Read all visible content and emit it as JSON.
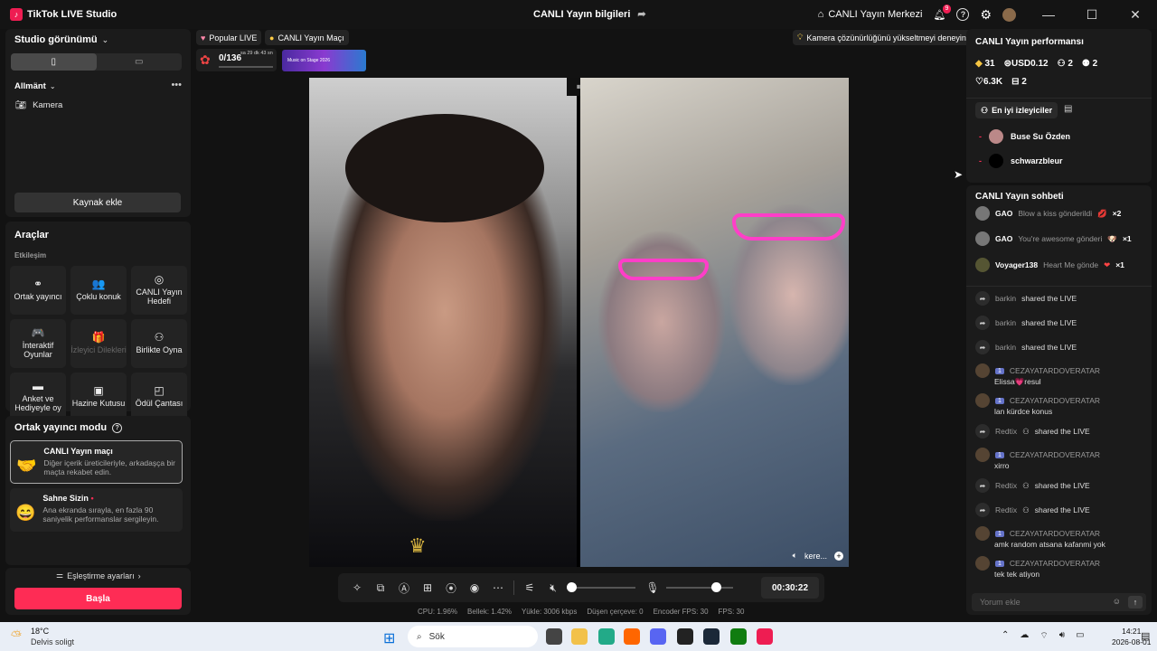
{
  "titlebar": {
    "app_name": "TikTok LIVE Studio",
    "center_title": "CANLI Yayın bilgileri",
    "live_center": "CANLI Yayın Merkezi",
    "notif_count": "9"
  },
  "left": {
    "studio_view": "Studio görünümü",
    "scene_label": "Allmänt",
    "source_camera": "Kamera",
    "add_source": "Kaynak ekle",
    "tools_title": "Araçlar",
    "interaction": "Etkileşim",
    "tools": [
      {
        "label": "Ortak yayıncı",
        "icon": "link-icon",
        "glyph": "⚭",
        "enabled": true
      },
      {
        "label": "Çoklu konuk",
        "icon": "users-icon",
        "glyph": "👥",
        "enabled": true
      },
      {
        "label": "CANLI Yayın Hedefi",
        "icon": "target-icon",
        "glyph": "◎",
        "enabled": true
      },
      {
        "label": "İnteraktif Oyunlar",
        "icon": "gamepad-icon",
        "glyph": "🎮",
        "enabled": true
      },
      {
        "label": "İzleyici Dilekleri",
        "icon": "gift-icon",
        "glyph": "🎁",
        "enabled": false
      },
      {
        "label": "Birlikte Oyna",
        "icon": "play-together-icon",
        "glyph": "⚇",
        "enabled": true
      },
      {
        "label": "Anket ve Hediyeyle oy",
        "icon": "poll-icon",
        "glyph": "▬",
        "enabled": true
      },
      {
        "label": "Hazine Kutusu",
        "icon": "treasure-icon",
        "glyph": "▣",
        "enabled": true
      },
      {
        "label": "Ödül Çantası",
        "icon": "bag-icon",
        "glyph": "◰",
        "enabled": true
      }
    ],
    "cohost_mode": "Ortak yayıncı modu",
    "mode1_title": "CANLI Yayın maçı",
    "mode1_desc": "Diğer içerik üreticileriyle, arkadaşça bir maçta rekabet edin.",
    "mode2_title": "Sahne Sizin",
    "mode2_desc": "Ana ekranda sırayla, en fazla 90 saniyelik performanslar sergileyin.",
    "pairing_settings": "Eşleştirme ayarları",
    "start": "Başla"
  },
  "center": {
    "tag1": "Popular LIVE",
    "tag2": "CANLI Yayın Maçı",
    "hint": "Kamera çözünürlüğünü yükseltmeyi deneyin",
    "goal_count": "0/136",
    "goal_time": "sa 29 dk 43 sn",
    "banner_text": "Music on Stage 2026",
    "guest_name": "kere...",
    "timer": "00:30:22",
    "stats": [
      "CPU: 1.96%",
      "Bellek: 1.42%",
      "Yükle: 3006 kbps",
      "Düşen çerçeve: 0",
      "Encoder FPS: 30",
      "FPS: 30"
    ]
  },
  "right": {
    "perf_title": "CANLI Yayın performansı",
    "perf": {
      "diamonds": "31",
      "usd": "USD0.12",
      "viewers": "2",
      "followers": "2",
      "likes": "6.3K",
      "gifts": "2"
    },
    "top_viewers_tab": "En iyi izleyiciler",
    "viewers": [
      {
        "rank": "-",
        "name": "Buse Su Özden"
      },
      {
        "rank": "-",
        "name": "schwarzbleur"
      }
    ],
    "chat_title": "CANLI Yayın sohbeti",
    "gifts": [
      {
        "user": "GAO",
        "text": "Blow a kiss gönderildi",
        "count": "×2"
      },
      {
        "user": "GAO",
        "text": "You're awesome gönderi",
        "count": "×1"
      },
      {
        "user": "Voyager138",
        "text": "Heart Me gönde",
        "count": "×1"
      }
    ],
    "shares": [
      {
        "user": "barkin",
        "text": "shared the LIVE"
      },
      {
        "user": "barkin",
        "text": "shared the LIVE"
      },
      {
        "user": "barkin",
        "text": "shared the LIVE"
      }
    ],
    "msgs": [
      {
        "user": "CEZAYATARDOVERATAR",
        "level": "1",
        "text": "Elissa💗resul"
      },
      {
        "user": "CEZAYATARDOVERATAR",
        "level": "1",
        "text": "lan kürdce konus"
      }
    ],
    "redtix1": {
      "user": "Redtix",
      "text": "shared the LIVE"
    },
    "msg3": {
      "user": "CEZAYATARDOVERATAR",
      "level": "1",
      "text": "xirro"
    },
    "redtix2": {
      "user": "Redtix",
      "text": "shared the LIVE"
    },
    "redtix3": {
      "user": "Redtix",
      "text": "shared the LIVE"
    },
    "msg4": {
      "user": "CEZAYATARDOVERATAR",
      "level": "1",
      "text": "amk random atsana kafanmi yok"
    },
    "msg5": {
      "user": "CEZAYATARDOVERATAR",
      "level": "1",
      "text": "tek tek atiyon"
    },
    "comment_placeholder": "Yorum ekle"
  },
  "taskbar": {
    "weather_temp": "18°C",
    "weather_desc": "Delvis soligt",
    "search": "Sök",
    "time": "14:21",
    "date": "2026-08-01"
  }
}
